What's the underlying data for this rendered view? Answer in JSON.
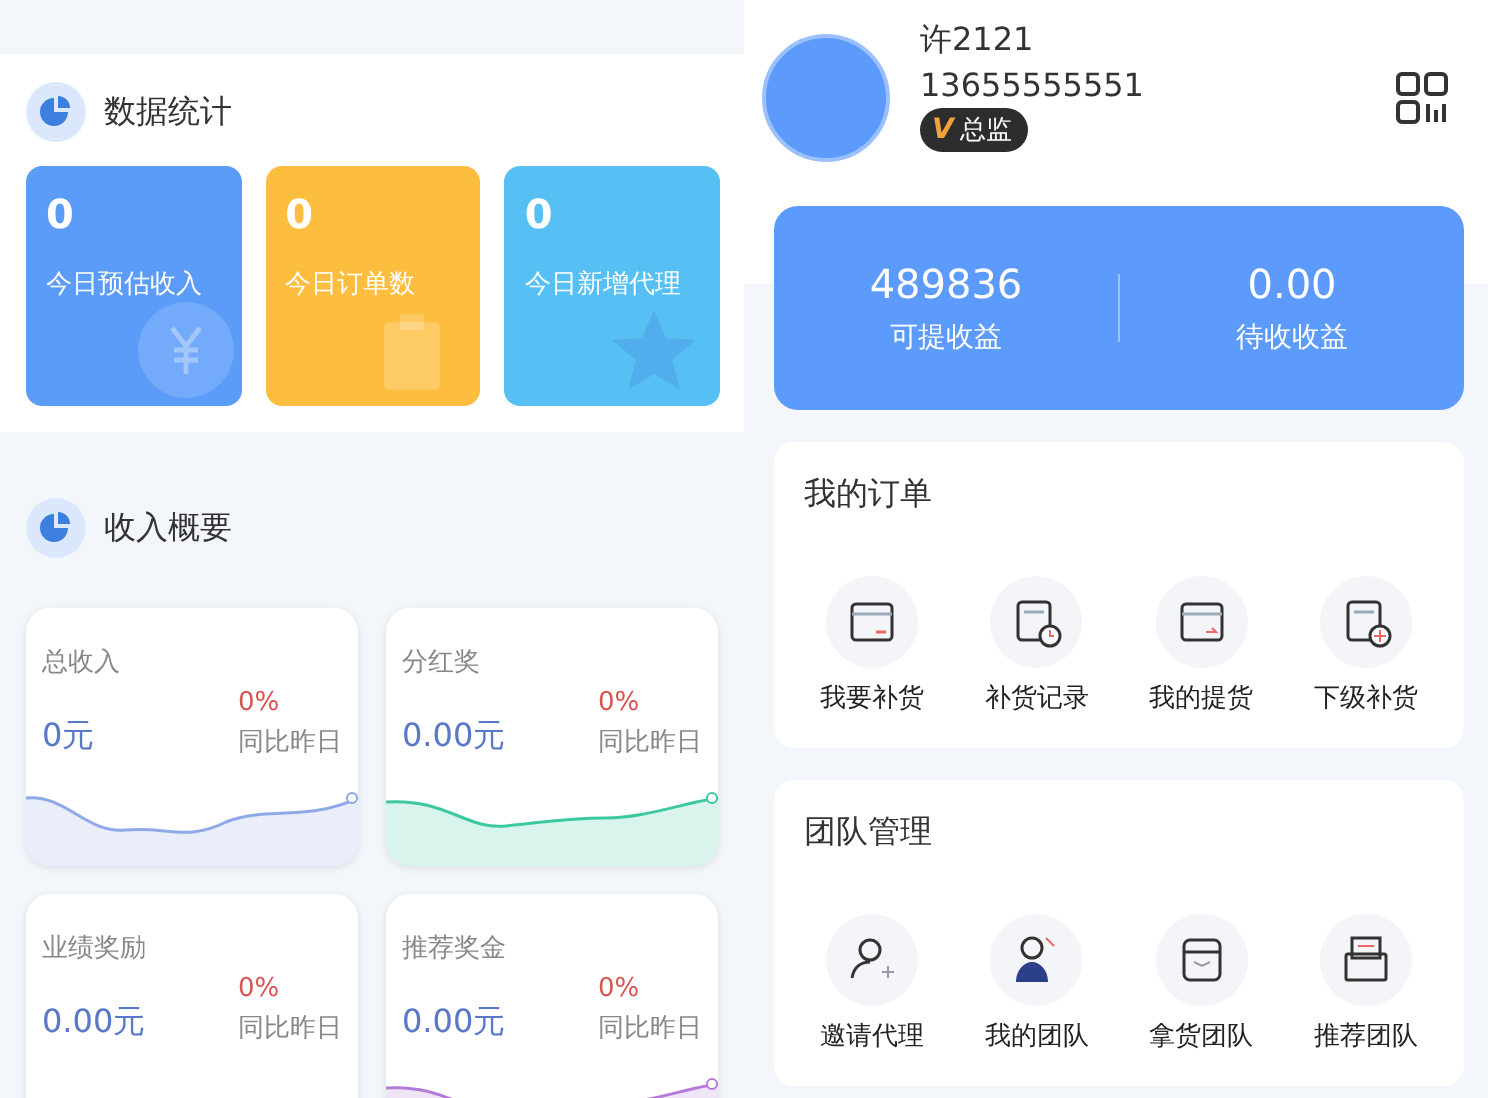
{
  "stats": {
    "title": "数据统计",
    "cards": [
      {
        "kind": "yuan",
        "value": "0",
        "label": "今日预估收入",
        "color": "#5b9cf8"
      },
      {
        "kind": "clipboard",
        "value": "0",
        "label": "今日订单数",
        "color": "#fdbd3e"
      },
      {
        "kind": "star",
        "value": "0",
        "label": "今日新增代理",
        "color": "#56c0f5"
      }
    ]
  },
  "income": {
    "title": "收入概要",
    "cards": [
      {
        "title": "总收入",
        "amount": "0元",
        "change": "0%",
        "compare": "同比昨日",
        "color": "#8fa9e6"
      },
      {
        "title": "分红奖",
        "amount": "0.00元",
        "change": "0%",
        "compare": "同比昨日",
        "color": "#3cc9a0"
      },
      {
        "title": "业绩奖励",
        "amount": "0.00元",
        "change": "0%",
        "compare": "同比昨日"
      },
      {
        "title": "推荐奖金",
        "amount": "0.00元",
        "change": "0%",
        "compare": "同比昨日",
        "color": "#b57bd8"
      }
    ]
  },
  "profile": {
    "name": "许2121",
    "phone": "13655555551",
    "badge_icon": "V",
    "badge": "总监"
  },
  "earnings": [
    {
      "value": "489836",
      "label": "可提收益"
    },
    {
      "value": "0.00",
      "label": "待收收益"
    }
  ],
  "orders": {
    "title": "我的订单",
    "items": [
      {
        "kind": "card-minus",
        "label": "我要补货"
      },
      {
        "kind": "doc-clock",
        "label": "补货记录"
      },
      {
        "kind": "card-arrow",
        "label": "我的提货"
      },
      {
        "kind": "doc-plus",
        "label": "下级补货"
      }
    ]
  },
  "team": {
    "title": "团队管理",
    "items": [
      {
        "kind": "user-plus",
        "label": "邀请代理"
      },
      {
        "kind": "user-tie",
        "label": "我的团队"
      },
      {
        "kind": "box",
        "label": "拿货团队"
      },
      {
        "kind": "envelope",
        "label": "推荐团队"
      }
    ]
  }
}
